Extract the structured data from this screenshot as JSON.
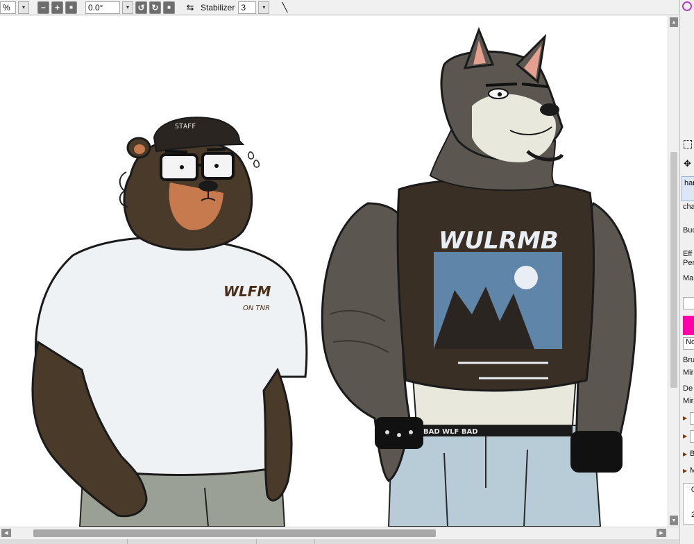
{
  "toolbar": {
    "zoom_value": "%",
    "rotation_value": "0.0°",
    "stabilizer_label": "Stabilizer",
    "stabilizer_value": "3",
    "dropdown_glyph": "▾",
    "zoom_out_glyph": "−",
    "zoom_in_glyph": "+",
    "zoom_reset_glyph": "■",
    "rotate_left_glyph": "↺",
    "rotate_right_glyph": "↻",
    "rotate_reset_glyph": "■",
    "flip_glyph": "⇆",
    "line_glyph": "╲"
  },
  "scroll": {
    "up": "▲",
    "down": "▼",
    "left": "◀",
    "right": "▶"
  },
  "artwork": {
    "bear_cap_text": "STAFF",
    "bear_shirt_text": "WLFM",
    "bear_shirt_subtext": "ON TNR",
    "wolf_shirt_text": "WULRMB",
    "wolf_belt_text": "BAD WLF BAD"
  },
  "right_panel": {
    "tool_partial_1": "har",
    "tool_partial_2": "cha",
    "tool_partial_3": "Buc",
    "label_eff": "Eff",
    "label_per": "Per",
    "label_ma": "Ma",
    "label_no": "No",
    "label_bru": "Bru",
    "label_min1": "Mir",
    "label_de": "De",
    "label_min2": "Mir",
    "label_b": "B",
    "label_m": "M",
    "label_0": "0",
    "label_2": "2",
    "color_swatch": "#ff00aa",
    "arrow_glyph": "▶"
  },
  "colors": {
    "bear_fur": "#4a3a2a",
    "bear_muzzle": "#c77a4e",
    "bear_shirt": "#eef2f4",
    "bear_pants": "#9aa093",
    "wolf_fur": "#5b5750",
    "wolf_light": "#e8e8dd",
    "wolf_shirt": "#3a2f24",
    "wolf_print": "#5f86a8",
    "wolf_jeans": "#b8ccd8"
  }
}
